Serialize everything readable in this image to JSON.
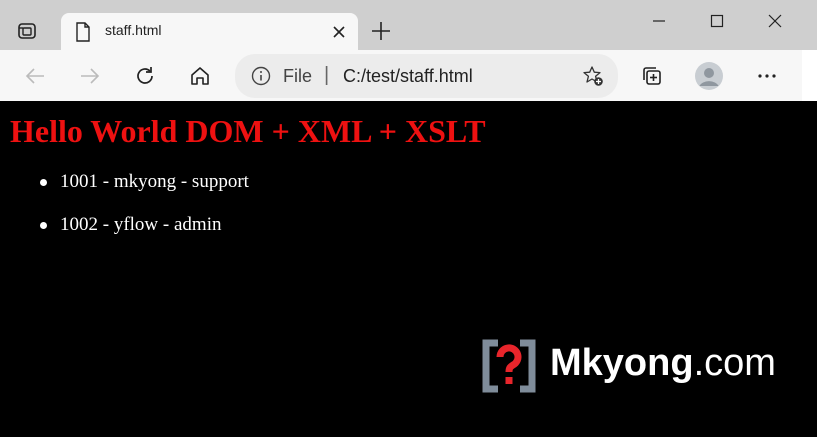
{
  "tab": {
    "title": "staff.html"
  },
  "address": {
    "scheme_label": "File",
    "separator": "|",
    "url": "C:/test/staff.html"
  },
  "page": {
    "heading": "Hello World DOM + XML + XSLT",
    "items": [
      "1001 - mkyong - support",
      "1002 - yflow - admin"
    ]
  },
  "logo": {
    "brand": "Mkyong",
    "suffix": ".com"
  },
  "colors": {
    "heading": "#ee1111",
    "background": "#000000",
    "tabstrip": "#cfcfcf",
    "toolbar": "#f7f7f7"
  }
}
